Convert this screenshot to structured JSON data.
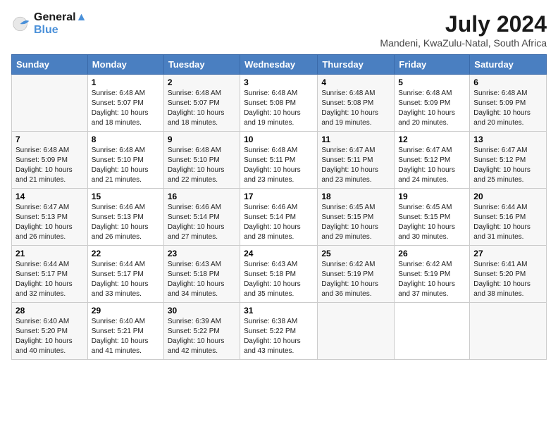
{
  "header": {
    "logo_line1": "General",
    "logo_line2": "Blue",
    "main_title": "July 2024",
    "subtitle": "Mandeni, KwaZulu-Natal, South Africa"
  },
  "columns": [
    "Sunday",
    "Monday",
    "Tuesday",
    "Wednesday",
    "Thursday",
    "Friday",
    "Saturday"
  ],
  "weeks": [
    [
      {
        "num": "",
        "info": ""
      },
      {
        "num": "1",
        "info": "Sunrise: 6:48 AM\nSunset: 5:07 PM\nDaylight: 10 hours\nand 18 minutes."
      },
      {
        "num": "2",
        "info": "Sunrise: 6:48 AM\nSunset: 5:07 PM\nDaylight: 10 hours\nand 18 minutes."
      },
      {
        "num": "3",
        "info": "Sunrise: 6:48 AM\nSunset: 5:08 PM\nDaylight: 10 hours\nand 19 minutes."
      },
      {
        "num": "4",
        "info": "Sunrise: 6:48 AM\nSunset: 5:08 PM\nDaylight: 10 hours\nand 19 minutes."
      },
      {
        "num": "5",
        "info": "Sunrise: 6:48 AM\nSunset: 5:09 PM\nDaylight: 10 hours\nand 20 minutes."
      },
      {
        "num": "6",
        "info": "Sunrise: 6:48 AM\nSunset: 5:09 PM\nDaylight: 10 hours\nand 20 minutes."
      }
    ],
    [
      {
        "num": "7",
        "info": "Sunrise: 6:48 AM\nSunset: 5:09 PM\nDaylight: 10 hours\nand 21 minutes."
      },
      {
        "num": "8",
        "info": "Sunrise: 6:48 AM\nSunset: 5:10 PM\nDaylight: 10 hours\nand 21 minutes."
      },
      {
        "num": "9",
        "info": "Sunrise: 6:48 AM\nSunset: 5:10 PM\nDaylight: 10 hours\nand 22 minutes."
      },
      {
        "num": "10",
        "info": "Sunrise: 6:48 AM\nSunset: 5:11 PM\nDaylight: 10 hours\nand 23 minutes."
      },
      {
        "num": "11",
        "info": "Sunrise: 6:47 AM\nSunset: 5:11 PM\nDaylight: 10 hours\nand 23 minutes."
      },
      {
        "num": "12",
        "info": "Sunrise: 6:47 AM\nSunset: 5:12 PM\nDaylight: 10 hours\nand 24 minutes."
      },
      {
        "num": "13",
        "info": "Sunrise: 6:47 AM\nSunset: 5:12 PM\nDaylight: 10 hours\nand 25 minutes."
      }
    ],
    [
      {
        "num": "14",
        "info": "Sunrise: 6:47 AM\nSunset: 5:13 PM\nDaylight: 10 hours\nand 26 minutes."
      },
      {
        "num": "15",
        "info": "Sunrise: 6:46 AM\nSunset: 5:13 PM\nDaylight: 10 hours\nand 26 minutes."
      },
      {
        "num": "16",
        "info": "Sunrise: 6:46 AM\nSunset: 5:14 PM\nDaylight: 10 hours\nand 27 minutes."
      },
      {
        "num": "17",
        "info": "Sunrise: 6:46 AM\nSunset: 5:14 PM\nDaylight: 10 hours\nand 28 minutes."
      },
      {
        "num": "18",
        "info": "Sunrise: 6:45 AM\nSunset: 5:15 PM\nDaylight: 10 hours\nand 29 minutes."
      },
      {
        "num": "19",
        "info": "Sunrise: 6:45 AM\nSunset: 5:15 PM\nDaylight: 10 hours\nand 30 minutes."
      },
      {
        "num": "20",
        "info": "Sunrise: 6:44 AM\nSunset: 5:16 PM\nDaylight: 10 hours\nand 31 minutes."
      }
    ],
    [
      {
        "num": "21",
        "info": "Sunrise: 6:44 AM\nSunset: 5:17 PM\nDaylight: 10 hours\nand 32 minutes."
      },
      {
        "num": "22",
        "info": "Sunrise: 6:44 AM\nSunset: 5:17 PM\nDaylight: 10 hours\nand 33 minutes."
      },
      {
        "num": "23",
        "info": "Sunrise: 6:43 AM\nSunset: 5:18 PM\nDaylight: 10 hours\nand 34 minutes."
      },
      {
        "num": "24",
        "info": "Sunrise: 6:43 AM\nSunset: 5:18 PM\nDaylight: 10 hours\nand 35 minutes."
      },
      {
        "num": "25",
        "info": "Sunrise: 6:42 AM\nSunset: 5:19 PM\nDaylight: 10 hours\nand 36 minutes."
      },
      {
        "num": "26",
        "info": "Sunrise: 6:42 AM\nSunset: 5:19 PM\nDaylight: 10 hours\nand 37 minutes."
      },
      {
        "num": "27",
        "info": "Sunrise: 6:41 AM\nSunset: 5:20 PM\nDaylight: 10 hours\nand 38 minutes."
      }
    ],
    [
      {
        "num": "28",
        "info": "Sunrise: 6:40 AM\nSunset: 5:20 PM\nDaylight: 10 hours\nand 40 minutes."
      },
      {
        "num": "29",
        "info": "Sunrise: 6:40 AM\nSunset: 5:21 PM\nDaylight: 10 hours\nand 41 minutes."
      },
      {
        "num": "30",
        "info": "Sunrise: 6:39 AM\nSunset: 5:22 PM\nDaylight: 10 hours\nand 42 minutes."
      },
      {
        "num": "31",
        "info": "Sunrise: 6:38 AM\nSunset: 5:22 PM\nDaylight: 10 hours\nand 43 minutes."
      },
      {
        "num": "",
        "info": ""
      },
      {
        "num": "",
        "info": ""
      },
      {
        "num": "",
        "info": ""
      }
    ]
  ]
}
